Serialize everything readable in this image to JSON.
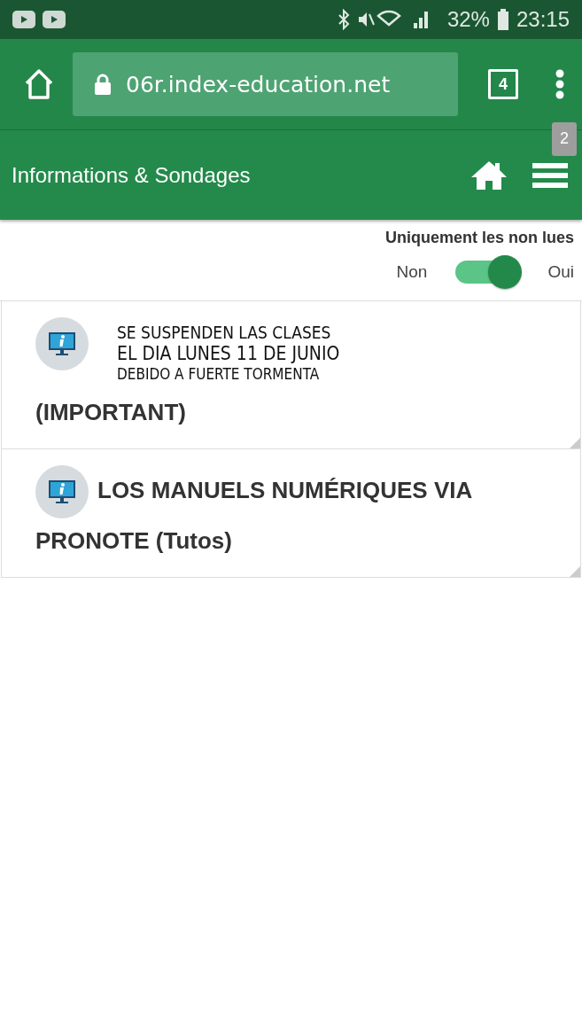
{
  "status_bar": {
    "battery": "32%",
    "time": "23:15"
  },
  "browser": {
    "url": "06r.index-education.net",
    "tab_count": "4"
  },
  "app_bar": {
    "title": "Informations & Sondages",
    "menu_badge": "2"
  },
  "filter": {
    "label": "Uniquement les non lues",
    "off_label": "Non",
    "on_label": "Oui",
    "on": true
  },
  "items": [
    {
      "note_lines": [
        "SE SUSPENDEN LAS CLASES",
        "EL DIA LUNES 11 DE JUNIO",
        "DEBIDO A FUERTE TORMENTA"
      ],
      "title": "(IMPORTANT)"
    },
    {
      "title": "LOS MANUELS NUMÉRIQUES VIA PRONOTE (Tutos)"
    }
  ]
}
